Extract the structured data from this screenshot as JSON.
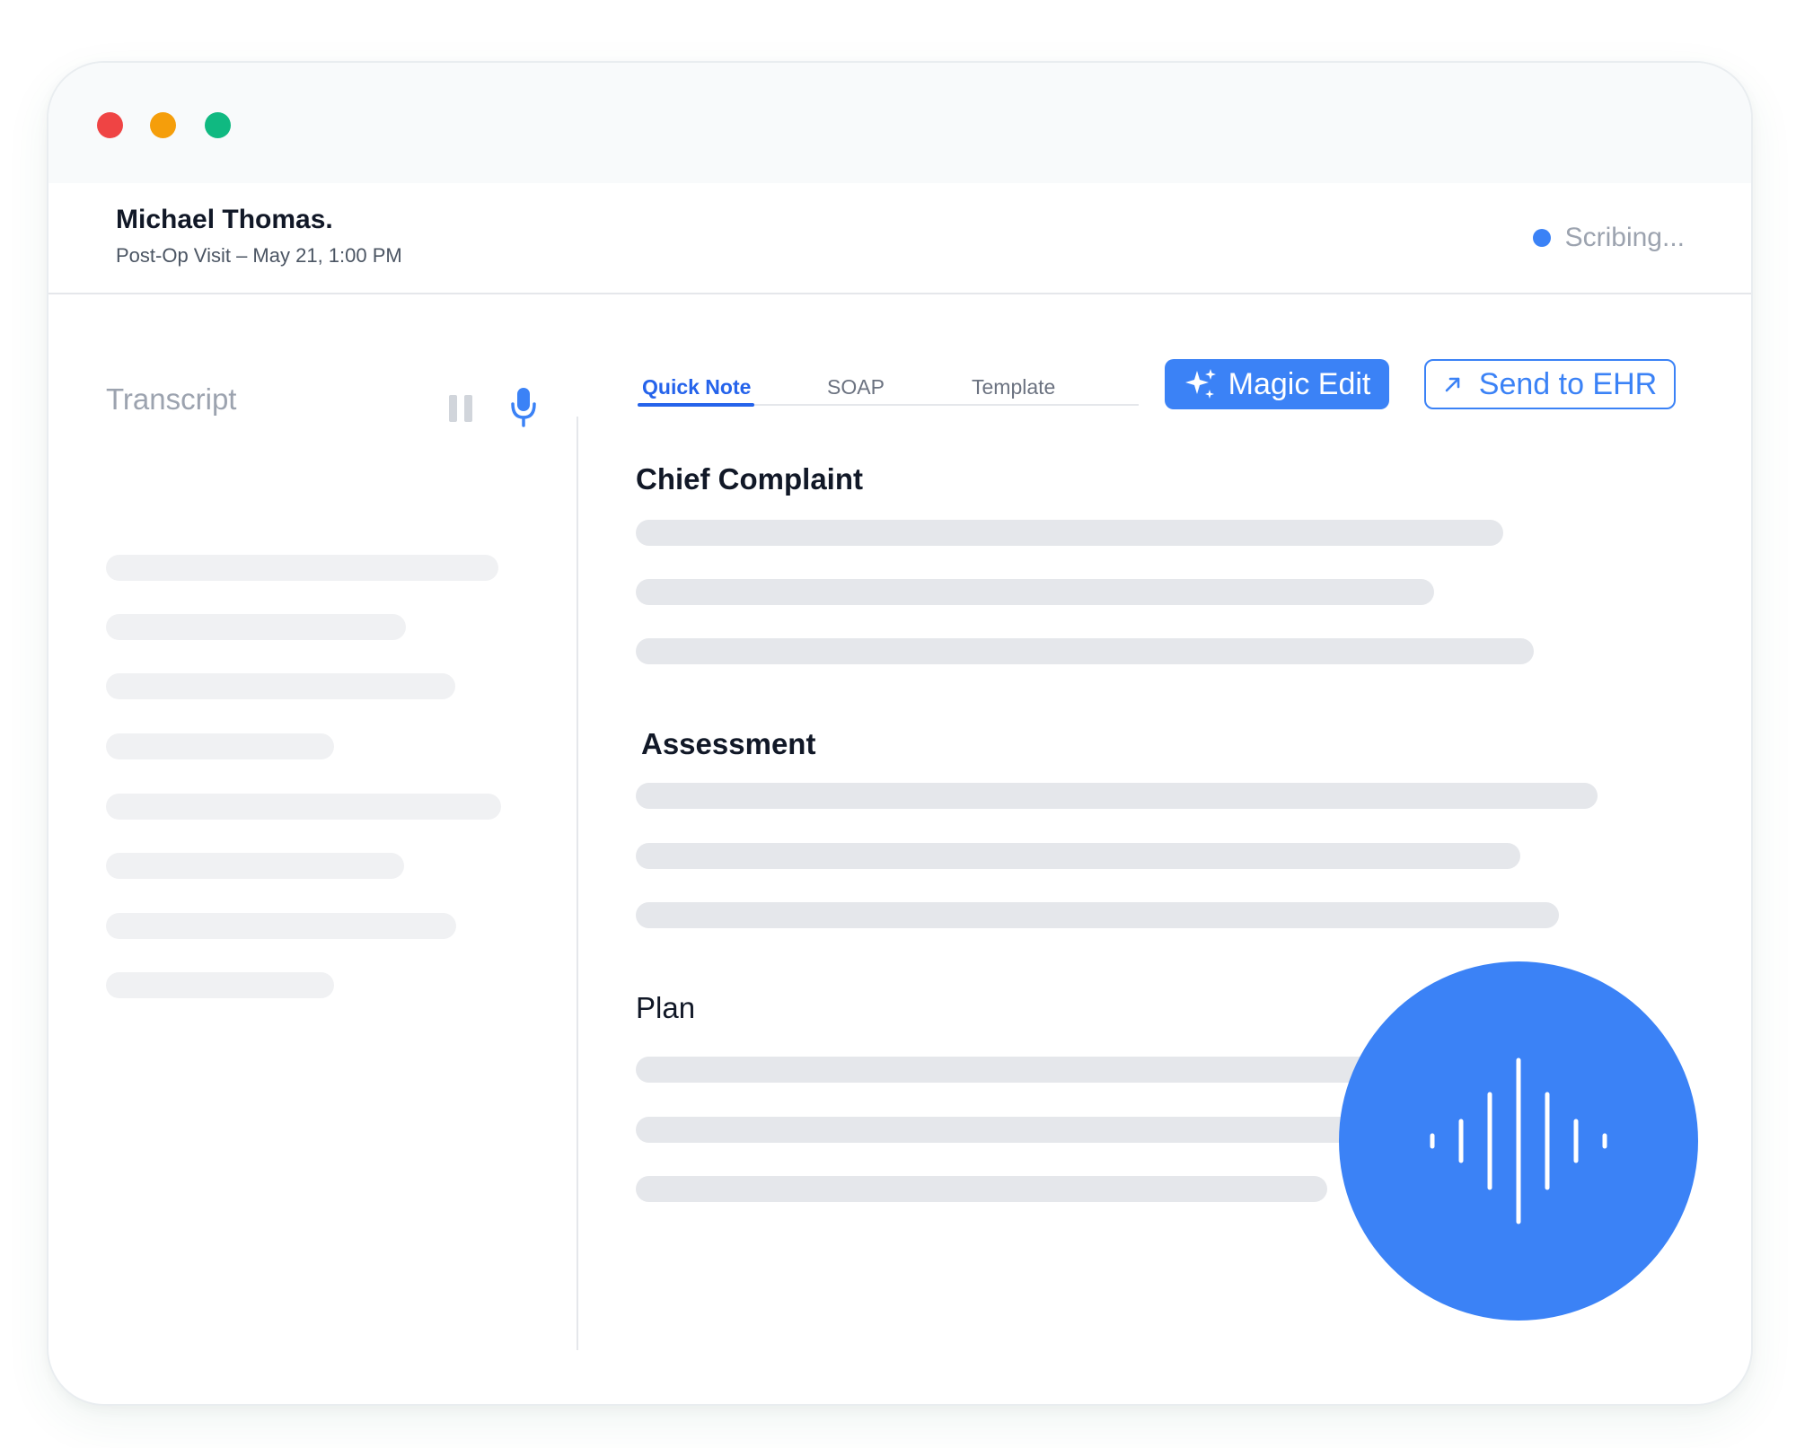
{
  "window": {
    "traffic_lights": {
      "close": "#ef4444",
      "minimize": "#f59e0b",
      "maximize": "#10b981"
    }
  },
  "header": {
    "patient_name": "Michael Thomas.",
    "visit_info": "Post-Op Visit – May 21, 1:00 PM",
    "status_text": "Scribing...",
    "status_color": "#3b82f6"
  },
  "transcript": {
    "title": "Transcript",
    "pause_icon": "pause-icon",
    "mic_icon": "microphone-icon"
  },
  "tabs": [
    {
      "label": "Quick Note",
      "active": true
    },
    {
      "label": "SOAP",
      "active": false
    },
    {
      "label": "Template",
      "active": false
    }
  ],
  "toolbar": {
    "magic_edit_label": "Magic Edit",
    "magic_edit_icon": "sparkles-icon",
    "send_to_ehr_label": "Send to EHR",
    "send_to_ehr_icon": "arrow-up-right-icon"
  },
  "sections": [
    {
      "title": "Chief Complaint"
    },
    {
      "title": "Assessment"
    },
    {
      "title": "Plan"
    }
  ],
  "voice_button": {
    "icon": "sound-wave-icon",
    "color": "#3b82f6"
  },
  "colors": {
    "accent": "#3b82f6",
    "active_tab": "#2563eb",
    "placeholder_line": "#e5e7eb"
  }
}
